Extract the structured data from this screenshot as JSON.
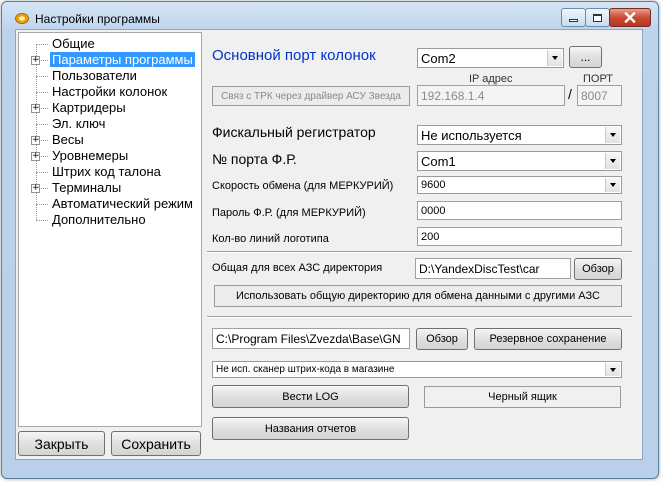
{
  "window": {
    "title": "Настройки программы"
  },
  "tree": {
    "items": [
      {
        "label": "Общие",
        "expandable": false,
        "selected": false
      },
      {
        "label": "Параметры программы",
        "expandable": true,
        "selected": true
      },
      {
        "label": "Пользователи",
        "expandable": false,
        "selected": false
      },
      {
        "label": "Настройки колонок",
        "expandable": false,
        "selected": false
      },
      {
        "label": "Картридеры",
        "expandable": true,
        "selected": false
      },
      {
        "label": "Эл. ключ",
        "expandable": false,
        "selected": false
      },
      {
        "label": "Весы",
        "expandable": true,
        "selected": false
      },
      {
        "label": "Уровнемеры",
        "expandable": true,
        "selected": false
      },
      {
        "label": "Штрих код талона",
        "expandable": false,
        "selected": false
      },
      {
        "label": "Терминалы",
        "expandable": true,
        "selected": false
      },
      {
        "label": "Автоматический режим",
        "expandable": false,
        "selected": false
      },
      {
        "label": "Дополнительно",
        "expandable": false,
        "selected": false
      }
    ],
    "expander_glyph": "+"
  },
  "footer": {
    "close_label": "Закрыть",
    "save_label": "Сохранить"
  },
  "main": {
    "port_label": "Основной порт колонок",
    "port_value": "Com2",
    "port_browse_label": "...",
    "ip_header": "IP адрес",
    "port_header": "ПОРТ",
    "trk_button_label": "Связ с ТРК через драйвер АСУ Звезда",
    "ip_value": "192.168.1.4",
    "ip_separator": "/",
    "ip_port_value": "8007",
    "fiscal_label": "Фискальный регистратор",
    "fiscal_value": "Не используется",
    "fr_port_label": "№ порта Ф.Р.",
    "fr_port_value": "Com1",
    "baud_label": "Скорость обмена (для МЕРКУРИЙ)",
    "baud_value": "9600",
    "password_label": "Пароль Ф.Р. (для МЕРКУРИЙ)",
    "password_value": "0000",
    "logo_lines_label": "Кол-во линий логотипа",
    "logo_lines_value": "200",
    "shared_dir_label": "Общая для всех АЗС директория",
    "shared_dir_value": "D:\\YandexDiscTest\\car",
    "shared_browse_label": "Обзор",
    "use_shared_label": "Использовать общую директорию для  обмена данными  с другими АЗС",
    "path_value": "C:\\Program Files\\Zvezda\\Base\\GN",
    "path_browse_label": "Обзор",
    "backup_label": "Резервное сохранение",
    "scanner_value": "Не исп. сканер штрих-кода в магазине",
    "log_label": "Вести LOG",
    "blackbox_label": "Черный ящик",
    "report_names_label": "Названия отчетов"
  },
  "colors": {
    "accent_blue": "#0033cc",
    "selection": "#3399ff",
    "close_red": "#c84a35"
  }
}
